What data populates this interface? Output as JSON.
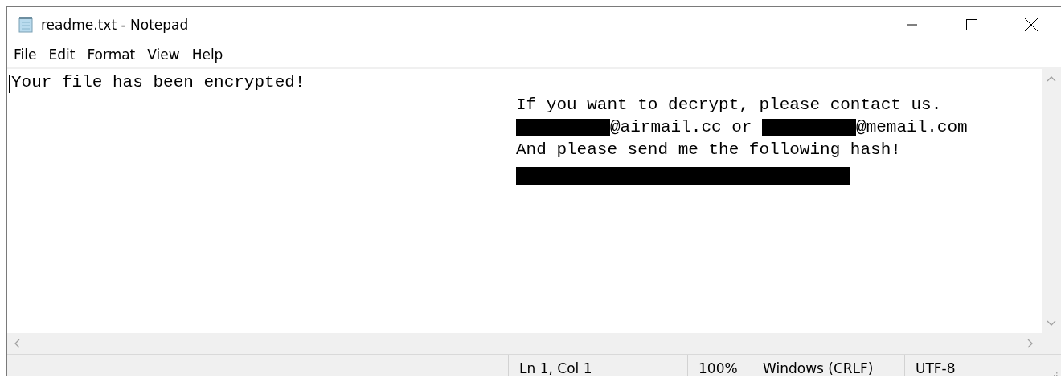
{
  "window": {
    "title": "readme.txt - Notepad"
  },
  "menu": [
    "File",
    "Edit",
    "Format",
    "View",
    "Help"
  ],
  "document": {
    "lines": [
      {
        "indented": false,
        "segments": [
          {
            "kind": "text",
            "text": "Your file has been encrypted!"
          }
        ]
      },
      {
        "indented": true,
        "segments": [
          {
            "kind": "text",
            "text": "If you want to decrypt, please contact us."
          }
        ]
      },
      {
        "indented": true,
        "segments": [
          {
            "kind": "redaction"
          },
          {
            "kind": "text",
            "text": "@airmail.cc or "
          },
          {
            "kind": "redaction"
          },
          {
            "kind": "text",
            "text": "@memail.com"
          }
        ]
      },
      {
        "indented": true,
        "segments": [
          {
            "kind": "text",
            "text": "And please send me the following hash!"
          }
        ]
      },
      {
        "indented": true,
        "segments": [
          {
            "kind": "blackout"
          }
        ]
      }
    ]
  },
  "status_bar": [
    "Ln 1, Col 1",
    "100%",
    "Windows (CRLF)",
    "UTF-8"
  ]
}
